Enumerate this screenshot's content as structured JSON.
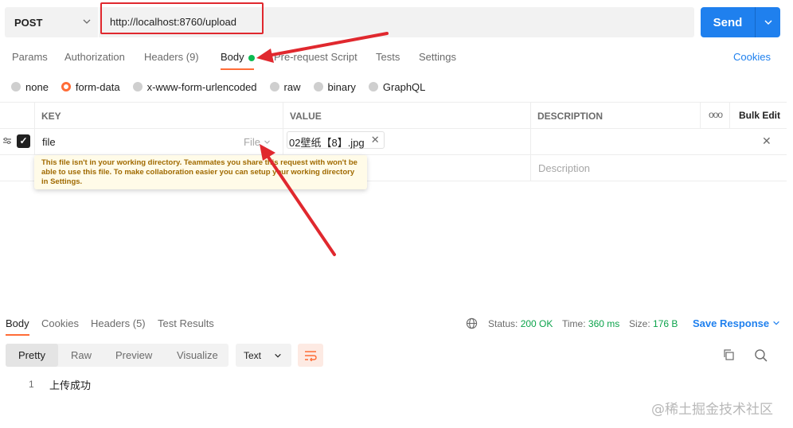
{
  "request": {
    "method": "POST",
    "url": "http://localhost:8760/upload",
    "send_label": "Send"
  },
  "tabs": [
    {
      "label": "Params"
    },
    {
      "label": "Authorization"
    },
    {
      "label": "Headers (9)"
    },
    {
      "label": "Body"
    },
    {
      "label": "Pre-request Script"
    },
    {
      "label": "Tests"
    },
    {
      "label": "Settings"
    }
  ],
  "cookies_label": "Cookies",
  "body_types": [
    "none",
    "form-data",
    "x-www-form-urlencoded",
    "raw",
    "binary",
    "GraphQL"
  ],
  "selected_body_type": "form-data",
  "table": {
    "headers": {
      "key": "KEY",
      "value": "VALUE",
      "description": "DESCRIPTION",
      "bulk_edit": "Bulk Edit",
      "more": "ooo"
    },
    "rows": [
      {
        "key": "file",
        "type": "File",
        "value": "02壁纸【8】.jpg",
        "checked": true
      }
    ],
    "new_row": {
      "description_placeholder": "Description"
    }
  },
  "tooltip": "This file isn't in your working directory. Teammates you share this request with won't be able to use this file. To make collaboration easier you can setup your working directory in Settings.",
  "response": {
    "tabs": [
      {
        "label": "Body"
      },
      {
        "label": "Cookies"
      },
      {
        "label": "Headers (5)"
      },
      {
        "label": "Test Results"
      }
    ],
    "status_label": "Status:",
    "status_value": "200 OK",
    "time_label": "Time:",
    "time_value": "360 ms",
    "size_label": "Size:",
    "size_value": "176 B",
    "save_label": "Save Response",
    "formats": [
      "Pretty",
      "Raw",
      "Preview",
      "Visualize"
    ],
    "language": "Text",
    "line_number": "1",
    "body_text": "上传成功"
  },
  "watermark": "@稀土掘金技术社区",
  "colors": {
    "accent": "#ff6c37",
    "primary": "#1f80ee",
    "annotation": "#e0282e",
    "success": "#0cbb52"
  }
}
